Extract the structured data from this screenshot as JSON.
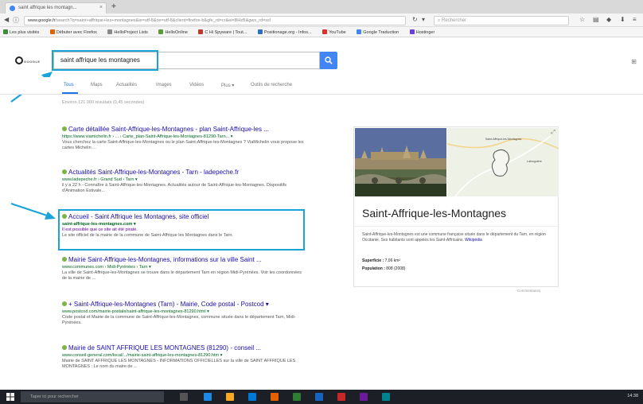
{
  "browser": {
    "tab_title": "saint affrique les montagn... ",
    "tab_close": "×",
    "new_tab": "+",
    "url_host": "www.google.fr",
    "url_rest": "/search?q=saint+affrique+les+montagnes&ie=utf-8&oe=utf-8&client=firefox-b&gfe_rd=cr&ei=BHzB&gws_rd=ssl",
    "search_placeholder": "Rechercher",
    "bookmarks": [
      {
        "label": "Les plus visités",
        "color": "#3f8c3f"
      },
      {
        "label": "Débuter avec Firefox",
        "color": "#e66000"
      },
      {
        "label": "HelloProject Lists",
        "color": "#8a8a8a"
      },
      {
        "label": "HelloOnline",
        "color": "#5b9b3a"
      },
      {
        "label": "C Hi Spyware | Tout...",
        "color": "#c0392b"
      },
      {
        "label": "Positionage.org - Infos...",
        "color": "#2e6fbf"
      },
      {
        "label": "YouTube",
        "color": "#e52d27"
      },
      {
        "label": "Google Traduction",
        "color": "#4285f4"
      },
      {
        "label": "Hostinger",
        "color": "#673de6"
      }
    ]
  },
  "google": {
    "logo": "GOOGLE",
    "query": "saint affrique les montagnes",
    "tabs": [
      "Tous",
      "Maps",
      "Actualités",
      "Images",
      "Vidéos",
      "Plus ▾",
      "Outils de recherche"
    ],
    "stats": "Environ 121 000 résultats (0,45 secondes)"
  },
  "results": [
    {
      "title": "Carte détaillée Saint-Affrique-les-Montagnes - plan Saint-Affrique-les ...",
      "url": "https://www.viamichelin.fr › ... › Carte_plan-Saint-Affrique-les-Montagnes-81290-Tarn... ▾",
      "snippet": "Vous cherchez la carte Saint-Affrique-les-Montagnes ou le plan Saint-Affrique-les-Montagnes ? ViaMichelin vous propose les cartes Michelin ...",
      "visited": ""
    },
    {
      "title": "Actualités Saint-Affrique-les-Montagnes - Tarn - ladepeche.fr",
      "url": "www.ladepeche.fr › Grand Sud › Tarn ▾",
      "snippet": "il y a 22 h - Connaître à Saint-Affrique-les-Montagnes. Actualités autour de Saint-Affrique-les-Montagnes. Dispositifs d'Animation Estivale...",
      "visited": ""
    },
    {
      "title": "Accueil - Saint Affrique les Montagnes, site officiel",
      "url": "saint-affrique-les-montagnes.com ▾",
      "snippet": "Le site officiel de la mairie de la commune de Saint-Affrique les Montagnes dans le Tarn.",
      "visited": "Il est possible que ce site ait été piraté."
    },
    {
      "title": "Mairie Saint-Affrique-les-Montagnes, informations sur la ville Saint ...",
      "url": "www.communes.com › Midi-Pyrénées › Tarn ▾",
      "snippet": "La ville de Saint-Affrique-les-Montagnes se trouve dans le département Tarn en région Midi-Pyrénées. Voir les coordonnées de la mairie de ...",
      "visited": ""
    },
    {
      "title": "+ Saint-Affrique-les-Montagnes (Tarn) - Mairie, Code postal - Postcod ▾",
      "url": "www.postcod.com/mairie-postale/saint-affrique-les-montagnes-81290.html ▾",
      "snippet": "Code postal et Mairie de la commune de Saint-Affrique-les-Montagnes, commune située dans le département Tarn, Midi-Pyrénées.",
      "visited": ""
    },
    {
      "title": "Mairie de SAINT AFFRIQUE LES MONTAGNES (81290) - conseil ...",
      "url": "www.conseil-general.com/local/.../mairie-saint-affrique-les-montagnes-81290.htm ▾",
      "snippet": "Mairie de SAINT AFFRIQUE LES MONTAGNES - INFORMATIONS OFFICIELLES sur la ville de SAINT AFFRIQUE LES MONTAGNES : Le nom du maire de ...",
      "visited": ""
    }
  ],
  "knowledge_panel": {
    "title": "Saint-Affrique-les-Montagnes",
    "description": "Saint-Affrique-les-Montagnes est une commune française située dans le département du Tarn, en région Occitanie. Ses habitants sont appelés les Saint-Affricains.",
    "wiki_link": "Wikipédia",
    "map_label_1": "Saint-Affrique-les-Montagnes",
    "map_label_2": "Labruguière",
    "facts": [
      {
        "label": "Superficie :",
        "value": "7,06 km²"
      },
      {
        "label": "Population :",
        "value": "808 (2008)"
      }
    ],
    "feedback": "Commentaires"
  },
  "taskbar": {
    "search_placeholder": "Taper ici pour rechercher",
    "clock": "14:38"
  },
  "colors": {
    "highlight_outline": "#1aa3d8",
    "link": "#1a0dab",
    "url_green": "#006621",
    "search_blue": "#4285f4"
  }
}
